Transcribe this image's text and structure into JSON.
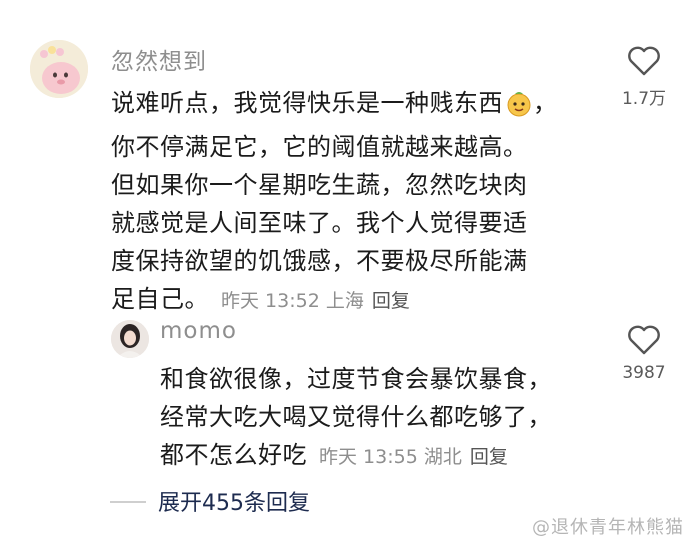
{
  "comment": {
    "username": "忽然想到",
    "lines": [
      "说难听点，我觉得快乐是一种贱东西",
      "你不停满足它，它的阈值就越来越高。",
      "但如果你一个星期吃生蔬，忽然吃块肉",
      "就感觉是人间至味了。我个人觉得要适",
      "度保持欲望的饥饿感，不要极尽所能满",
      "足自己。"
    ],
    "line1_tail": "，",
    "timestamp": "昨天 13:52",
    "location": "上海",
    "reply_label": "回复",
    "like_count": "1.7万"
  },
  "reply": {
    "username": "momo",
    "lines": [
      "和食欲很像，过度节食会暴饮暴食，",
      "经常大吃大喝又觉得什么都吃够了，",
      "都不怎么好吃"
    ],
    "timestamp": "昨天 13:55",
    "location": "湖北",
    "reply_label": "回复",
    "like_count": "3987"
  },
  "expand_label": "展开455条回复",
  "watermark": "@退休青年林熊猫",
  "icons": {
    "like": "heart-outline-icon",
    "emoji": "smiling-fruit-emoji"
  }
}
